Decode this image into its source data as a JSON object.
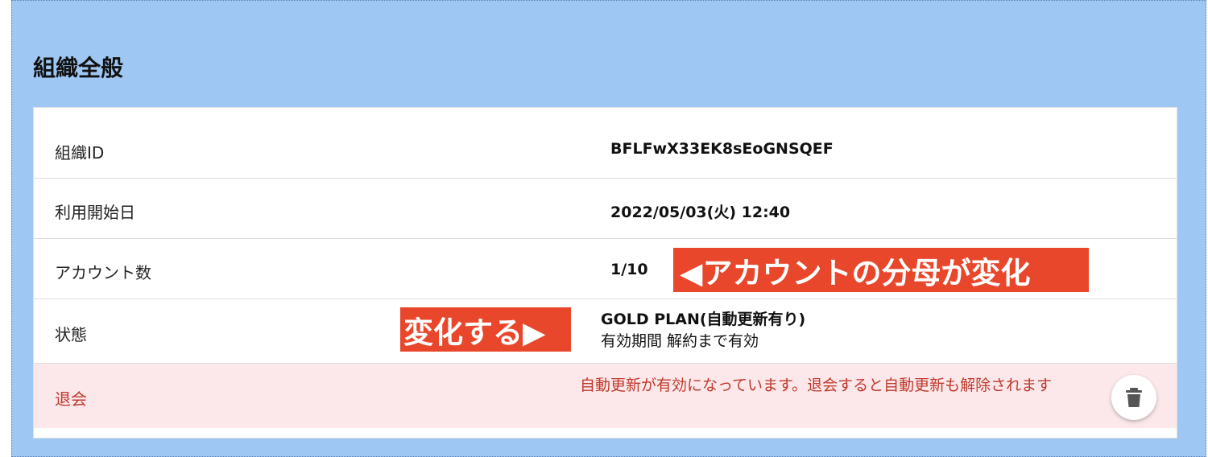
{
  "section": {
    "title": "組織全般"
  },
  "rows": {
    "org_id": {
      "label": "組織ID",
      "value": "BFLFwX33EK8sEoGNSQEF"
    },
    "start_date": {
      "label": "利用開始日",
      "value": "2022/05/03(火) 12:40"
    },
    "accounts": {
      "label": "アカウント数",
      "value": "1/10"
    },
    "status": {
      "label": "状態",
      "plan": "GOLD PLAN(自動更新有り)",
      "validity": "有効期間 解約まで有効"
    },
    "withdraw": {
      "label": "退会",
      "warning": "自動更新が有効になっています。退会すると自動更新も解除されます",
      "icon": "trash-icon"
    }
  },
  "annotations": {
    "account_note": "◀アカウントの分母が変化",
    "status_note": "変化する▶"
  },
  "colors": {
    "background": "#9ec7f3",
    "annotation": "#e8472b",
    "danger_text": "#c0392b",
    "danger_bg": "#fce8ea"
  }
}
